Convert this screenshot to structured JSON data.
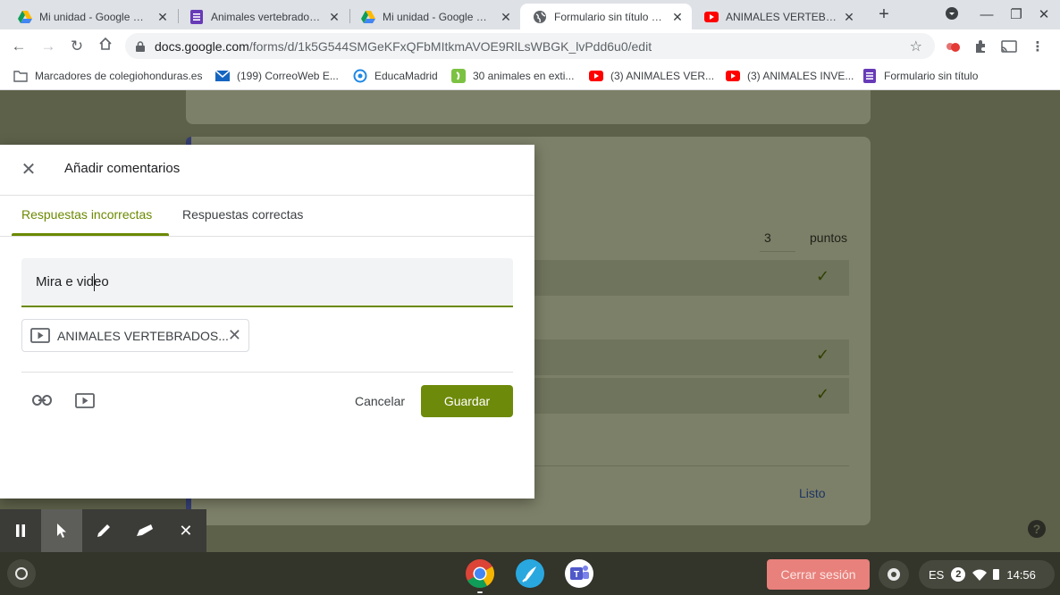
{
  "browser": {
    "tabs": [
      {
        "title": "Mi unidad - Google Drive",
        "favicon": "google-drive-icon",
        "active": false
      },
      {
        "title": "Animales vertebrados - Google Forms",
        "favicon": "google-forms-icon",
        "active": false
      },
      {
        "title": "Mi unidad - Google Drive",
        "favicon": "google-drive-icon",
        "active": false
      },
      {
        "title": "Formulario sin título - Formularios de Google",
        "favicon": "globe-icon",
        "active": true
      },
      {
        "title": "ANIMALES VERTEBRADOS",
        "favicon": "youtube-icon",
        "active": false
      }
    ],
    "new_tab": "+",
    "url_host": "docs.google.com",
    "url_path": "/forms/d/1k5G544SMGeKFxQFbMItkmAVOE9RlLsWBGK_lvPdd6u0/edit"
  },
  "bookmarks": [
    {
      "label": "Marcadores de colegiohonduras.es",
      "icon": "folder-icon"
    },
    {
      "label": "(199) CorreoWeb E...",
      "icon": "mail-icon"
    },
    {
      "label": "EducaMadrid",
      "icon": "educamadrid-icon"
    },
    {
      "label": "30 animales en exti...",
      "icon": "bookmark-green-icon"
    },
    {
      "label": "(3) ANIMALES VER...",
      "icon": "youtube-icon"
    },
    {
      "label": "(3) ANIMALES INVE...",
      "icon": "youtube-icon"
    },
    {
      "label": "Formulario sin título",
      "icon": "google-forms-icon"
    }
  ],
  "background_form": {
    "points_value": "3",
    "points_label": "puntos",
    "done_label": "Listo"
  },
  "dialog": {
    "title": "Añadir comentarios",
    "tabs": [
      {
        "label": "Respuestas incorrectas",
        "active": true
      },
      {
        "label": "Respuestas correctas",
        "active": false
      }
    ],
    "feedback_text": "Mira e video",
    "attachment_label": "ANIMALES VERTEBRADOS...",
    "cancel_label": "Cancelar",
    "save_label": "Guardar"
  },
  "shelf": {
    "sign_out_label": "Cerrar sesión",
    "language": "ES",
    "notification_count": "2",
    "time": "14:56"
  },
  "colors": {
    "accent": "#6b8900",
    "save_button": "#6e8a0a",
    "sign_out_button": "#e8807b"
  }
}
